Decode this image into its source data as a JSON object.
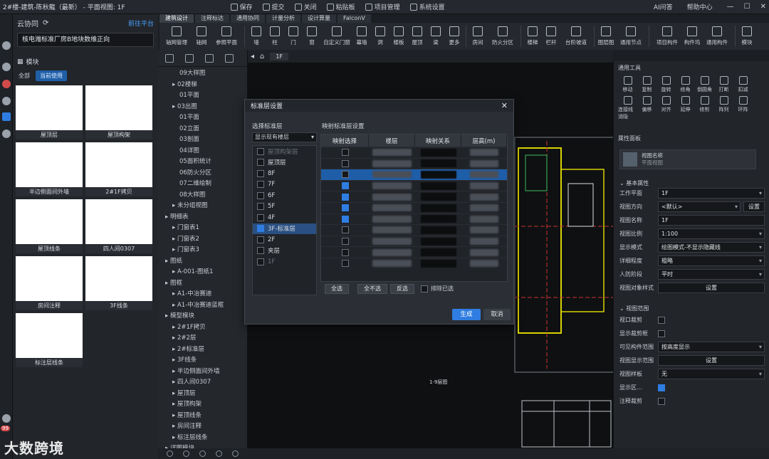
{
  "titlebar": {
    "title": "2#楼-建筑-陈秋龍（最新） - 平面视图: 1F",
    "actions": [
      "保存",
      "提交",
      "关闭",
      "粘贴板",
      "项目管理",
      "系统设置"
    ],
    "right": [
      "AI问答",
      "帮助中心"
    ]
  },
  "tabs": [
    "建筑设计",
    "注释标达",
    "通用协同",
    "计量分析",
    "设计算量",
    "FalconV"
  ],
  "ribbon": [
    "轴网管理",
    "轴网",
    "参照平面",
    "墙",
    "柱",
    "门",
    "窗",
    "自定义门窗",
    "幕墙",
    "洞",
    "楼板",
    "屋顶",
    "梁",
    "更多",
    "房间",
    "防火分区",
    "楼梯",
    "栏杆",
    "台阶坡道",
    "图层图",
    "通用节点",
    "项目构件",
    "构件坞",
    "通用构件",
    "模块"
  ],
  "left": {
    "header": "云协同",
    "platform": "前往平台",
    "project": "核电潍标准厂房B地块数维正向",
    "module_title": "模块",
    "filters": [
      "全部",
      "当前使用"
    ],
    "cards": [
      "屋顶层",
      "屋顶构架",
      "半边侧面间外墙",
      "2#1F拷贝",
      "屋顶线条",
      "四人间0307",
      "房间注释",
      "3F线条",
      "标注层线条"
    ]
  },
  "tree": [
    {
      "t": "09大样图",
      "lvl": 2
    },
    {
      "t": "02楼梯",
      "lvl": 1
    },
    {
      "t": "01平面",
      "lvl": 2
    },
    {
      "t": "03出图",
      "lvl": 1
    },
    {
      "t": "01平面",
      "lvl": 2
    },
    {
      "t": "02立面",
      "lvl": 2
    },
    {
      "t": "03剖面",
      "lvl": 2
    },
    {
      "t": "04详图",
      "lvl": 2
    },
    {
      "t": "05面积统计",
      "lvl": 2
    },
    {
      "t": "06防火分区",
      "lvl": 2
    },
    {
      "t": "07二维绘制",
      "lvl": 2
    },
    {
      "t": "08大样图",
      "lvl": 2
    },
    {
      "t": "未分组视图",
      "lvl": 1
    },
    {
      "t": "明细表",
      "lvl": 0
    },
    {
      "t": "门窗表1",
      "lvl": 1
    },
    {
      "t": "门窗表2",
      "lvl": 1
    },
    {
      "t": "门窗表3",
      "lvl": 1
    },
    {
      "t": "图纸",
      "lvl": 0
    },
    {
      "t": "A-001-图纸1",
      "lvl": 1
    },
    {
      "t": "图框",
      "lvl": 0
    },
    {
      "t": "A1-中冶赛迪",
      "lvl": 1
    },
    {
      "t": "A1-中冶赛迪蓝框",
      "lvl": 1
    },
    {
      "t": "模型模块",
      "lvl": 0
    },
    {
      "t": "2#1F拷贝",
      "lvl": 1
    },
    {
      "t": "2#2层",
      "lvl": 1
    },
    {
      "t": "2#标准层",
      "lvl": 1
    },
    {
      "t": "3F线条",
      "lvl": 1
    },
    {
      "t": "半边侧面间外墙",
      "lvl": 1
    },
    {
      "t": "四人间0307",
      "lvl": 1
    },
    {
      "t": "屋顶层",
      "lvl": 1
    },
    {
      "t": "屋顶构架",
      "lvl": 1
    },
    {
      "t": "屋顶线条",
      "lvl": 1
    },
    {
      "t": "房间注释",
      "lvl": 1
    },
    {
      "t": "标注层线条",
      "lvl": 1
    },
    {
      "t": "详图模块",
      "lvl": 0
    }
  ],
  "canvas": {
    "tab": "1F",
    "plan_label": "1-9层图"
  },
  "dialog": {
    "title": "标准层设置",
    "left_title": "选择标准层",
    "right_title": "映射标准层设置",
    "select_value": "显示现有楼层",
    "floors": [
      {
        "t": "屋顶构架层",
        "checked": false,
        "dim": true
      },
      {
        "t": "屋顶层",
        "checked": false
      },
      {
        "t": "8F",
        "checked": false
      },
      {
        "t": "7F",
        "checked": false
      },
      {
        "t": "6F",
        "checked": false
      },
      {
        "t": "5F",
        "checked": false
      },
      {
        "t": "4F",
        "checked": false
      },
      {
        "t": "3F-标准层",
        "checked": true,
        "selected": true
      },
      {
        "t": "2F",
        "checked": false
      },
      {
        "t": "夹层",
        "checked": false
      },
      {
        "t": "1F",
        "checked": false,
        "dim": true
      }
    ],
    "columns": [
      "映射选择",
      "楼层",
      "映射关系",
      "层高(m)"
    ],
    "rows": [
      {
        "checked": false
      },
      {
        "checked": false
      },
      {
        "checked": false,
        "hl": true
      },
      {
        "checked": true
      },
      {
        "checked": true
      },
      {
        "checked": true
      },
      {
        "checked": true
      },
      {
        "checked": false
      },
      {
        "checked": false
      },
      {
        "checked": false
      },
      {
        "checked": false
      }
    ],
    "buttons": [
      "全选",
      "全不选",
      "反选"
    ],
    "exclude_label": "排除已选",
    "generate": "生成",
    "cancel": "取消"
  },
  "right": {
    "tools_title": "通用工具",
    "tools": [
      "移动",
      "复制",
      "旋转",
      "修角",
      "倒圆角",
      "打断",
      "扣减",
      "连接线消隐",
      "偏移",
      "对齐",
      "延伸",
      "修剪",
      "阵列",
      "环阵"
    ],
    "props_title": "属性面板",
    "obj_title": "视图名称",
    "obj_sub": "平面视图",
    "basic": "基本属性",
    "props": [
      {
        "l": "工作平面",
        "v": "1F",
        "dd": true
      },
      {
        "l": "视图方向",
        "v": "<默认>",
        "dd": true,
        "btn": "设置"
      },
      {
        "l": "视图名称",
        "v": "1F"
      },
      {
        "l": "视图比例",
        "v": "1:100",
        "dd": true
      },
      {
        "l": "显示模式",
        "v": "绘图模式-不显示隐藏线",
        "dd": true
      },
      {
        "l": "详细程度",
        "v": "粗略",
        "dd": true
      },
      {
        "l": "人防阶段",
        "v": "平时",
        "dd": true
      },
      {
        "l": "视图对象样式",
        "v": "设置",
        "btnv": true
      }
    ],
    "range": "视图范围",
    "props2": [
      {
        "l": "视口裁剪",
        "chk": false
      },
      {
        "l": "显示裁剪框",
        "chk": false
      },
      {
        "l": "可见构件范围",
        "v": "按高度显示",
        "dd": true
      },
      {
        "l": "视图显示范围",
        "v": "设置",
        "btnv": true
      },
      {
        "l": "视图样板",
        "v": "无",
        "dd": true
      },
      {
        "l": "显示区…",
        "chk": true
      },
      {
        "l": "注释裁剪",
        "chk": false
      }
    ]
  },
  "watermark": "大数跨境",
  "badge": "99"
}
